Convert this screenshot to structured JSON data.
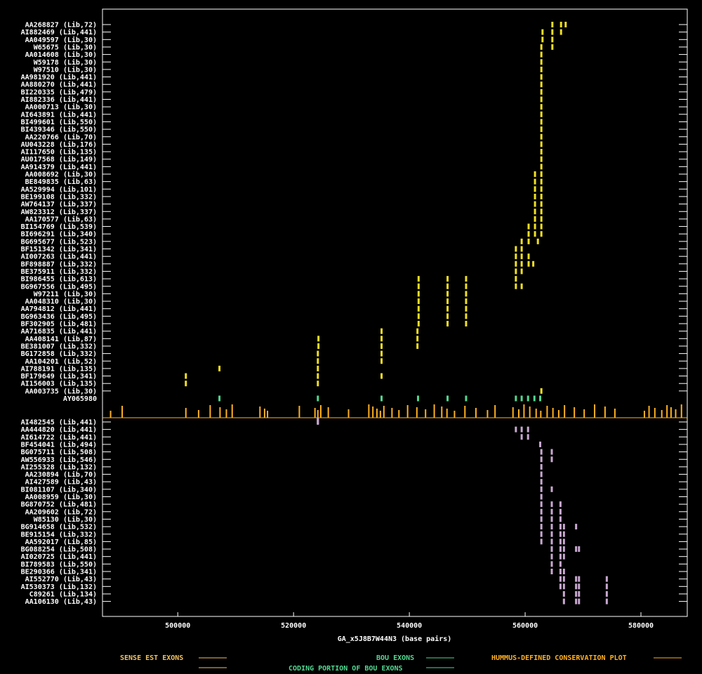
{
  "chart_data": {
    "type": "scatter",
    "xlabel": "GA_x5J8B7W44N3 (base pairs)",
    "xlim": [
      487000,
      588000
    ],
    "x_ticks": [
      500000,
      520000,
      540000,
      560000,
      580000
    ],
    "x_tick_labels": [
      "500000",
      "520000",
      "540000",
      "560000",
      "580000"
    ],
    "colors": {
      "sense": "#f0e020",
      "antisense": "#c8a8d0",
      "bou": "#50d890",
      "conservation": "#ffb020",
      "legend_sense": "#f0c060",
      "legend_bou": "#50d890",
      "legend_conservation": "#ffb020",
      "legend_coding": "#50d890"
    },
    "legend": {
      "sense": "SENSE EST EXONS",
      "bou": "BOU EXONS",
      "conservation": "HUMMUS-DEFINED CONSERVATION PLOT",
      "coding": "CODING PORTION OF BOU EXONS"
    },
    "sense_ests": [
      {
        "name": "AA268827 (Lib,72)",
        "exons": [
          564700,
          566200,
          567000
        ]
      },
      {
        "name": "AI882469 (Lib,441)",
        "exons": [
          563000,
          564700,
          566200
        ]
      },
      {
        "name": "AA049597 (Lib,30)",
        "exons": [
          563000,
          564700
        ]
      },
      {
        "name": "W65675 (Lib,30)",
        "exons": [
          562800,
          564700
        ]
      },
      {
        "name": "AA014608 (Lib,30)",
        "exons": [
          562800
        ]
      },
      {
        "name": "W59178 (Lib,30)",
        "exons": [
          562800
        ]
      },
      {
        "name": "W97510 (Lib,30)",
        "exons": [
          562800
        ]
      },
      {
        "name": "AA981920 (Lib,441)",
        "exons": [
          562800
        ]
      },
      {
        "name": "AA880270 (Lib,441)",
        "exons": [
          562800
        ]
      },
      {
        "name": "BI220335 (Lib,479)",
        "exons": [
          562800
        ]
      },
      {
        "name": "AI882336 (Lib,441)",
        "exons": [
          562800
        ]
      },
      {
        "name": "AA000713 (Lib,30)",
        "exons": [
          562800
        ]
      },
      {
        "name": "AI643891 (Lib,441)",
        "exons": [
          562800
        ]
      },
      {
        "name": "BI499601 (Lib,550)",
        "exons": [
          562800
        ]
      },
      {
        "name": "BI439346 (Lib,550)",
        "exons": [
          562800
        ]
      },
      {
        "name": "AA220766 (Lib,70)",
        "exons": [
          562800
        ]
      },
      {
        "name": "AU043228 (Lib,176)",
        "exons": [
          562800
        ]
      },
      {
        "name": "AI117650 (Lib,135)",
        "exons": [
          562800
        ]
      },
      {
        "name": "AU017568 (Lib,149)",
        "exons": [
          562800
        ]
      },
      {
        "name": "AA914379 (Lib,441)",
        "exons": [
          562800
        ]
      },
      {
        "name": "AA008692 (Lib,30)",
        "exons": [
          561700,
          562800
        ]
      },
      {
        "name": "BE849835 (Lib,63)",
        "exons": [
          561700,
          562800
        ]
      },
      {
        "name": "AA529994 (Lib,101)",
        "exons": [
          561700,
          562800
        ]
      },
      {
        "name": "BE199108 (Lib,332)",
        "exons": [
          561700,
          562800
        ]
      },
      {
        "name": "AW764137 (Lib,337)",
        "exons": [
          561700,
          562800
        ]
      },
      {
        "name": "AW823312 (Lib,337)",
        "exons": [
          561700,
          562800
        ]
      },
      {
        "name": "AA170577 (Lib,63)",
        "exons": [
          561700,
          562800
        ]
      },
      {
        "name": "BI154769 (Lib,539)",
        "exons": [
          560600,
          561700,
          562800
        ]
      },
      {
        "name": "BI696291 (Lib,340)",
        "exons": [
          560600,
          561700,
          562800
        ]
      },
      {
        "name": "BG695677 (Lib,523)",
        "exons": [
          559400,
          560600,
          562200
        ]
      },
      {
        "name": "BF151342 (Lib,341)",
        "exons": [
          558400,
          559400
        ]
      },
      {
        "name": "AI007263 (Lib,441)",
        "exons": [
          558400,
          559400,
          560600
        ]
      },
      {
        "name": "BF898887 (Lib,332)",
        "exons": [
          558400,
          559400,
          560600,
          561400
        ]
      },
      {
        "name": "BE375911 (Lib,332)",
        "exons": [
          558400,
          559400
        ]
      },
      {
        "name": "BI986455 (Lib,613)",
        "exons": [
          541600,
          546600,
          549800,
          558400
        ]
      },
      {
        "name": "BG967556 (Lib,495)",
        "exons": [
          541600,
          546600,
          549800,
          558400,
          559400
        ]
      },
      {
        "name": "W97211 (Lib,30)",
        "exons": [
          541600,
          546600,
          549800
        ]
      },
      {
        "name": "AA048310 (Lib,30)",
        "exons": [
          541600,
          546600,
          549800
        ]
      },
      {
        "name": "AA794812 (Lib,441)",
        "exons": [
          541600,
          546600,
          549800
        ]
      },
      {
        "name": "BG963436 (Lib,495)",
        "exons": [
          541600,
          546600,
          549800
        ]
      },
      {
        "name": "BF302905 (Lib,481)",
        "exons": [
          541600,
          546600,
          549800
        ]
      },
      {
        "name": "AA716835 (Lib,441)",
        "exons": [
          541400,
          535200
        ]
      },
      {
        "name": "AA408141 (Lib,87)",
        "exons": [
          524300,
          535200,
          541400
        ]
      },
      {
        "name": "BE381007 (Lib,332)",
        "exons": [
          524300,
          535200,
          541400
        ]
      },
      {
        "name": "BG172858 (Lib,332)",
        "exons": [
          524200,
          535200
        ]
      },
      {
        "name": "AA104201 (Lib,52)",
        "exons": [
          524200,
          535200
        ]
      },
      {
        "name": "AI788191 (Lib,135)",
        "exons": [
          507200,
          524200
        ]
      },
      {
        "name": "BF179649 (Lib,341)",
        "exons": [
          501400,
          524200,
          535200
        ]
      },
      {
        "name": "AI156003 (Lib,135)",
        "exons": [
          501400,
          524200
        ]
      },
      {
        "name": "AA003735 (Lib,30)",
        "exons": [
          562800
        ]
      }
    ],
    "bou": {
      "name": "AY065980",
      "exons": [
        507200,
        524200,
        535200,
        541500,
        546600,
        549800,
        558400,
        559400,
        560500,
        561600,
        562600
      ]
    },
    "conservation_peaks": [
      488400,
      490400,
      501400,
      503600,
      505600,
      507300,
      508400,
      509400,
      514200,
      515000,
      515500,
      521000,
      523700,
      524200,
      524700,
      526000,
      529500,
      533000,
      533700,
      534400,
      535000,
      535600,
      537000,
      538200,
      539700,
      541300,
      542800,
      544300,
      545600,
      546500,
      547800,
      549600,
      551500,
      553500,
      554800,
      557900,
      558900,
      559800,
      560800,
      561900,
      562700,
      563800,
      564800,
      565800,
      566800,
      568500,
      570200,
      572000,
      573800,
      575500,
      580600,
      581400,
      582400,
      583600,
      584500,
      585200,
      586000,
      587000
    ],
    "antisense_ests": [
      {
        "name": "AI482545 (Lib,441)",
        "exons": [
          524200
        ]
      },
      {
        "name": "AA444820 (Lib,441)",
        "exons": [
          558400,
          559400,
          560500
        ]
      },
      {
        "name": "AI614722 (Lib,441)",
        "exons": [
          559400,
          560500
        ]
      },
      {
        "name": "BF454041 (Lib,494)",
        "exons": [
          562600
        ]
      },
      {
        "name": "BG075711 (Lib,508)",
        "exons": [
          562800,
          564600
        ]
      },
      {
        "name": "AW556933 (Lib,546)",
        "exons": [
          562800,
          564600
        ]
      },
      {
        "name": "AI255328 (Lib,132)",
        "exons": [
          562800
        ]
      },
      {
        "name": "AA230894 (Lib,70)",
        "exons": [
          562800
        ]
      },
      {
        "name": "AI427589 (Lib,43)",
        "exons": [
          562800
        ]
      },
      {
        "name": "BI081107 (Lib,340)",
        "exons": [
          562800,
          564600
        ]
      },
      {
        "name": "AA008959 (Lib,30)",
        "exons": [
          562800
        ]
      },
      {
        "name": "BG870752 (Lib,481)",
        "exons": [
          562800,
          564600,
          566100
        ]
      },
      {
        "name": "AA209602 (Lib,72)",
        "exons": [
          562800,
          564600,
          566100
        ]
      },
      {
        "name": "W85130 (Lib,30)",
        "exons": [
          562800,
          564600,
          566100
        ]
      },
      {
        "name": "BG914658 (Lib,532)",
        "exons": [
          562800,
          564600,
          566100,
          566700,
          568800
        ]
      },
      {
        "name": "BE915154 (Lib,332)",
        "exons": [
          562800,
          564600,
          566100,
          566700
        ]
      },
      {
        "name": "AA592017 (Lib,85)",
        "exons": [
          562800,
          564600,
          566100,
          566700
        ]
      },
      {
        "name": "BG088254 (Lib,508)",
        "exons": [
          564600,
          566100,
          566700,
          568800,
          569300
        ]
      },
      {
        "name": "AI020725 (Lib,441)",
        "exons": [
          564600,
          566100,
          566700
        ]
      },
      {
        "name": "BI789583 (Lib,550)",
        "exons": [
          564600,
          566100
        ]
      },
      {
        "name": "BE290366 (Lib,341)",
        "exons": [
          564600,
          566100,
          566700
        ]
      },
      {
        "name": "AI552770 (Lib,43)",
        "exons": [
          566100,
          566700,
          568800,
          569300,
          574100
        ]
      },
      {
        "name": "AI530373 (Lib,132)",
        "exons": [
          566100,
          566700,
          568800,
          569300,
          574100
        ]
      },
      {
        "name": "C89261 (Lib,134)",
        "exons": [
          566700,
          568800,
          569300,
          574100
        ]
      },
      {
        "name": "AA106130 (Lib,43)",
        "exons": [
          566700,
          568800,
          569300,
          574100
        ]
      }
    ]
  }
}
